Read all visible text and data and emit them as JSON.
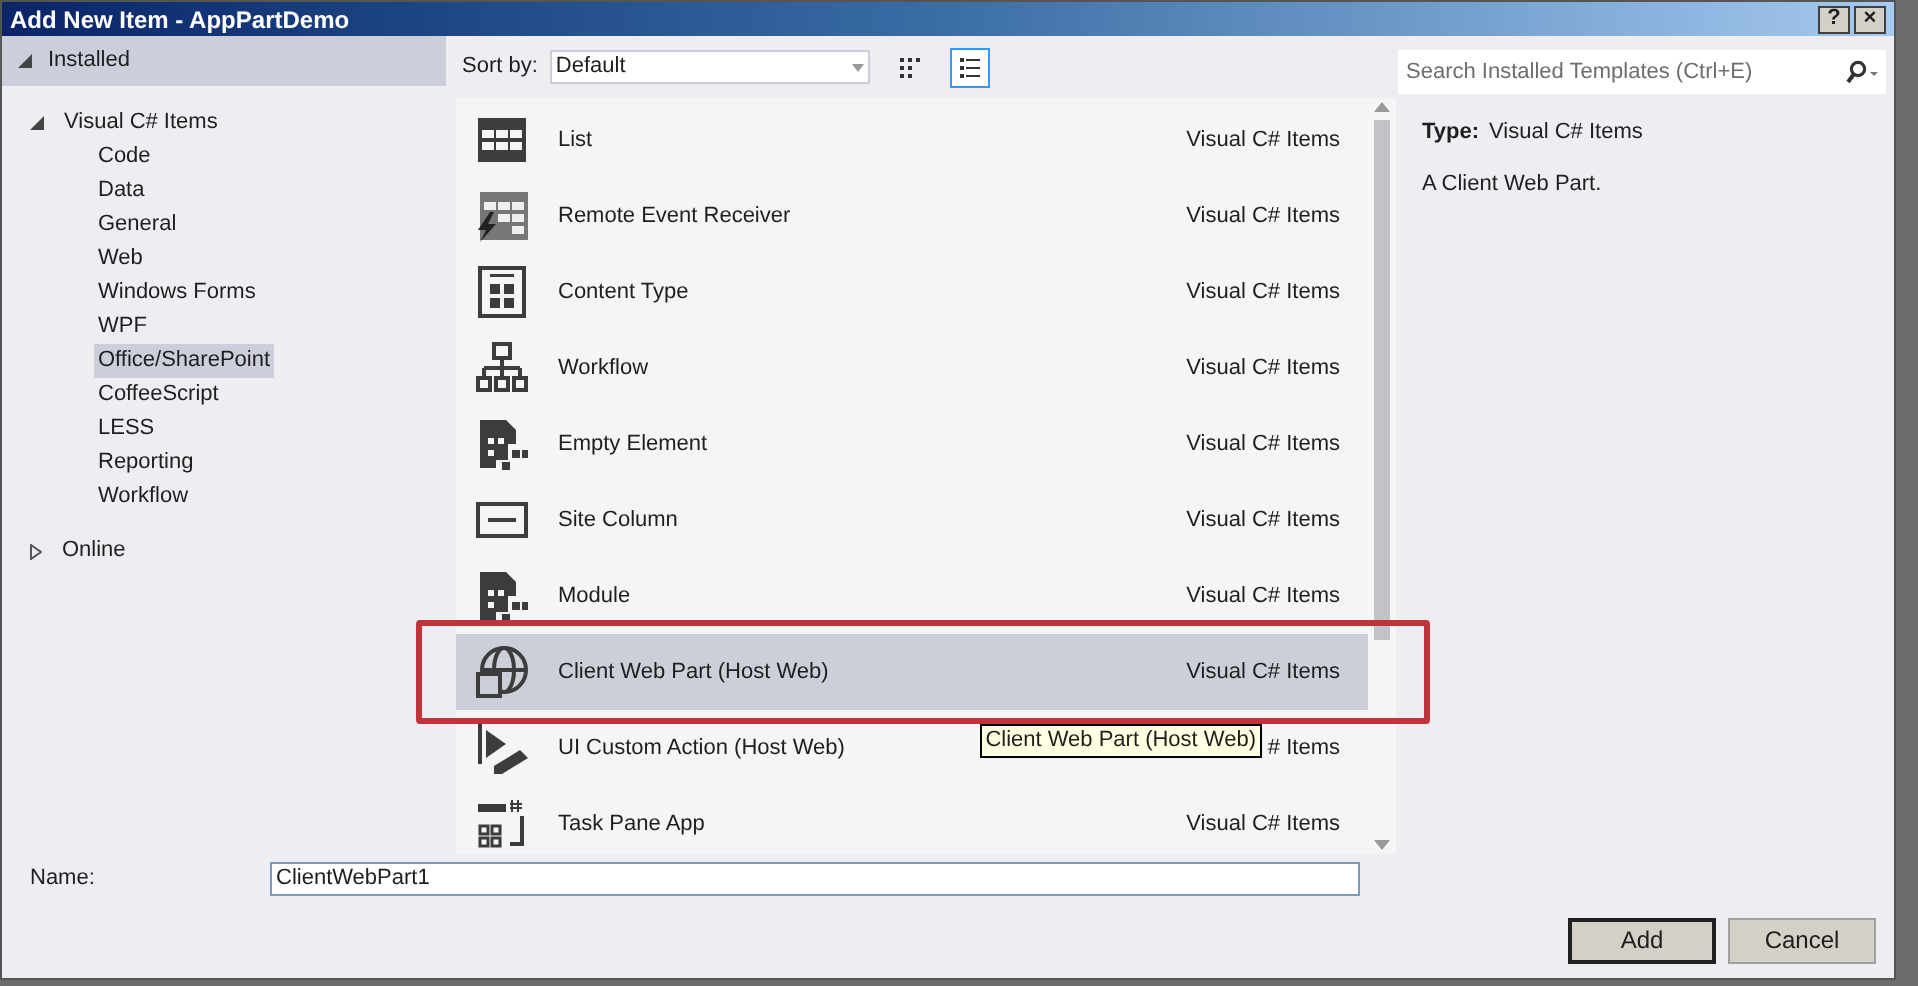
{
  "window": {
    "title": "Add New Item - AppPartDemo",
    "buttons": [
      "?",
      "×"
    ]
  },
  "tree": {
    "header": {
      "label": "Installed",
      "expanded": true
    },
    "items": [
      {
        "label": "Visual C# Items",
        "expanded": true,
        "selected": false,
        "children": [
          {
            "label": "Code",
            "selected": false
          },
          {
            "label": "Data",
            "selected": false
          },
          {
            "label": "General",
            "selected": false
          },
          {
            "label": "Web",
            "selected": false
          },
          {
            "label": "Windows Forms",
            "selected": false
          },
          {
            "label": "WPF",
            "selected": false
          },
          {
            "label": "Office/SharePoint",
            "selected": true
          },
          {
            "label": "CoffeeScript",
            "selected": false
          },
          {
            "label": "LESS",
            "selected": false
          },
          {
            "label": "Reporting",
            "selected": false
          },
          {
            "label": "Workflow",
            "selected": false
          }
        ]
      },
      {
        "label": "Online",
        "expanded": false,
        "selected": false
      }
    ]
  },
  "toolbar": {
    "sort_label": "Sort by:",
    "sort_value": "Default",
    "view_modes": [
      {
        "kind": "icons",
        "selected": false
      },
      {
        "kind": "list",
        "selected": true
      }
    ]
  },
  "search": {
    "placeholder": "Search Installed Templates (Ctrl+E)"
  },
  "templates": [
    {
      "name": "List",
      "category": "Visual C# Items",
      "selected": false
    },
    {
      "name": "Remote Event Receiver",
      "category": "Visual C# Items",
      "selected": false
    },
    {
      "name": "Content Type",
      "category": "Visual C# Items",
      "selected": false
    },
    {
      "name": "Workflow",
      "category": "Visual C# Items",
      "selected": false
    },
    {
      "name": "Empty Element",
      "category": "Visual C# Items",
      "selected": false
    },
    {
      "name": "Site Column",
      "category": "Visual C# Items",
      "selected": false
    },
    {
      "name": "Module",
      "category": "Visual C# Items",
      "selected": false
    },
    {
      "name": "Client Web Part (Host Web)",
      "category": "Visual C# Items",
      "selected": true
    },
    {
      "name": "UI Custom Action (Host Web)",
      "category": "# Items",
      "selected": false
    },
    {
      "name": "Task Pane App",
      "category": "Visual C# Items",
      "selected": false
    }
  ],
  "details": {
    "type_label": "Type:",
    "type_value": "Visual C# Items",
    "description": "A Client Web Part."
  },
  "tooltip": "Client Web Part (Host Web)",
  "name_field": {
    "label": "Name:",
    "value": "ClientWebPart1"
  },
  "buttons": [
    {
      "label": "Add",
      "default": true
    },
    {
      "label": "Cancel",
      "default": false
    }
  ]
}
